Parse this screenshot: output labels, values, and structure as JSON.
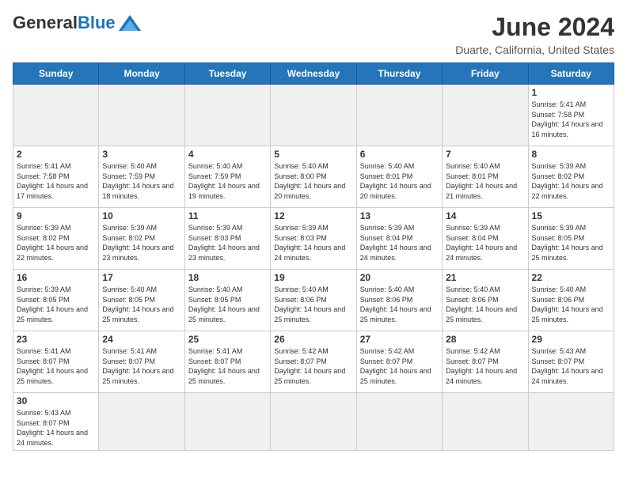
{
  "header": {
    "logo_general": "General",
    "logo_blue": "Blue",
    "title": "June 2024",
    "subtitle": "Duarte, California, United States"
  },
  "days_of_week": [
    "Sunday",
    "Monday",
    "Tuesday",
    "Wednesday",
    "Thursday",
    "Friday",
    "Saturday"
  ],
  "weeks": [
    [
      {
        "day": null,
        "info": ""
      },
      {
        "day": null,
        "info": ""
      },
      {
        "day": null,
        "info": ""
      },
      {
        "day": null,
        "info": ""
      },
      {
        "day": null,
        "info": ""
      },
      {
        "day": null,
        "info": ""
      },
      {
        "day": "1",
        "info": "Sunrise: 5:41 AM\nSunset: 7:58 PM\nDaylight: 14 hours\nand 16 minutes."
      }
    ],
    [
      {
        "day": "2",
        "info": "Sunrise: 5:41 AM\nSunset: 7:58 PM\nDaylight: 14 hours\nand 17 minutes."
      },
      {
        "day": "3",
        "info": "Sunrise: 5:40 AM\nSunset: 7:59 PM\nDaylight: 14 hours\nand 18 minutes."
      },
      {
        "day": "4",
        "info": "Sunrise: 5:40 AM\nSunset: 7:59 PM\nDaylight: 14 hours\nand 19 minutes."
      },
      {
        "day": "5",
        "info": "Sunrise: 5:40 AM\nSunset: 8:00 PM\nDaylight: 14 hours\nand 20 minutes."
      },
      {
        "day": "6",
        "info": "Sunrise: 5:40 AM\nSunset: 8:01 PM\nDaylight: 14 hours\nand 20 minutes."
      },
      {
        "day": "7",
        "info": "Sunrise: 5:40 AM\nSunset: 8:01 PM\nDaylight: 14 hours\nand 21 minutes."
      },
      {
        "day": "8",
        "info": "Sunrise: 5:39 AM\nSunset: 8:02 PM\nDaylight: 14 hours\nand 22 minutes."
      }
    ],
    [
      {
        "day": "9",
        "info": "Sunrise: 5:39 AM\nSunset: 8:02 PM\nDaylight: 14 hours\nand 22 minutes."
      },
      {
        "day": "10",
        "info": "Sunrise: 5:39 AM\nSunset: 8:02 PM\nDaylight: 14 hours\nand 23 minutes."
      },
      {
        "day": "11",
        "info": "Sunrise: 5:39 AM\nSunset: 8:03 PM\nDaylight: 14 hours\nand 23 minutes."
      },
      {
        "day": "12",
        "info": "Sunrise: 5:39 AM\nSunset: 8:03 PM\nDaylight: 14 hours\nand 24 minutes."
      },
      {
        "day": "13",
        "info": "Sunrise: 5:39 AM\nSunset: 8:04 PM\nDaylight: 14 hours\nand 24 minutes."
      },
      {
        "day": "14",
        "info": "Sunrise: 5:39 AM\nSunset: 8:04 PM\nDaylight: 14 hours\nand 24 minutes."
      },
      {
        "day": "15",
        "info": "Sunrise: 5:39 AM\nSunset: 8:05 PM\nDaylight: 14 hours\nand 25 minutes."
      }
    ],
    [
      {
        "day": "16",
        "info": "Sunrise: 5:39 AM\nSunset: 8:05 PM\nDaylight: 14 hours\nand 25 minutes."
      },
      {
        "day": "17",
        "info": "Sunrise: 5:40 AM\nSunset: 8:05 PM\nDaylight: 14 hours\nand 25 minutes."
      },
      {
        "day": "18",
        "info": "Sunrise: 5:40 AM\nSunset: 8:05 PM\nDaylight: 14 hours\nand 25 minutes."
      },
      {
        "day": "19",
        "info": "Sunrise: 5:40 AM\nSunset: 8:06 PM\nDaylight: 14 hours\nand 25 minutes."
      },
      {
        "day": "20",
        "info": "Sunrise: 5:40 AM\nSunset: 8:06 PM\nDaylight: 14 hours\nand 25 minutes."
      },
      {
        "day": "21",
        "info": "Sunrise: 5:40 AM\nSunset: 8:06 PM\nDaylight: 14 hours\nand 25 minutes."
      },
      {
        "day": "22",
        "info": "Sunrise: 5:40 AM\nSunset: 8:06 PM\nDaylight: 14 hours\nand 25 minutes."
      }
    ],
    [
      {
        "day": "23",
        "info": "Sunrise: 5:41 AM\nSunset: 8:07 PM\nDaylight: 14 hours\nand 25 minutes."
      },
      {
        "day": "24",
        "info": "Sunrise: 5:41 AM\nSunset: 8:07 PM\nDaylight: 14 hours\nand 25 minutes."
      },
      {
        "day": "25",
        "info": "Sunrise: 5:41 AM\nSunset: 8:07 PM\nDaylight: 14 hours\nand 25 minutes."
      },
      {
        "day": "26",
        "info": "Sunrise: 5:42 AM\nSunset: 8:07 PM\nDaylight: 14 hours\nand 25 minutes."
      },
      {
        "day": "27",
        "info": "Sunrise: 5:42 AM\nSunset: 8:07 PM\nDaylight: 14 hours\nand 25 minutes."
      },
      {
        "day": "28",
        "info": "Sunrise: 5:42 AM\nSunset: 8:07 PM\nDaylight: 14 hours\nand 24 minutes."
      },
      {
        "day": "29",
        "info": "Sunrise: 5:43 AM\nSunset: 8:07 PM\nDaylight: 14 hours\nand 24 minutes."
      }
    ],
    [
      {
        "day": "30",
        "info": "Sunrise: 5:43 AM\nSunset: 8:07 PM\nDaylight: 14 hours\nand 24 minutes."
      },
      {
        "day": null,
        "info": ""
      },
      {
        "day": null,
        "info": ""
      },
      {
        "day": null,
        "info": ""
      },
      {
        "day": null,
        "info": ""
      },
      {
        "day": null,
        "info": ""
      },
      {
        "day": null,
        "info": ""
      }
    ]
  ]
}
